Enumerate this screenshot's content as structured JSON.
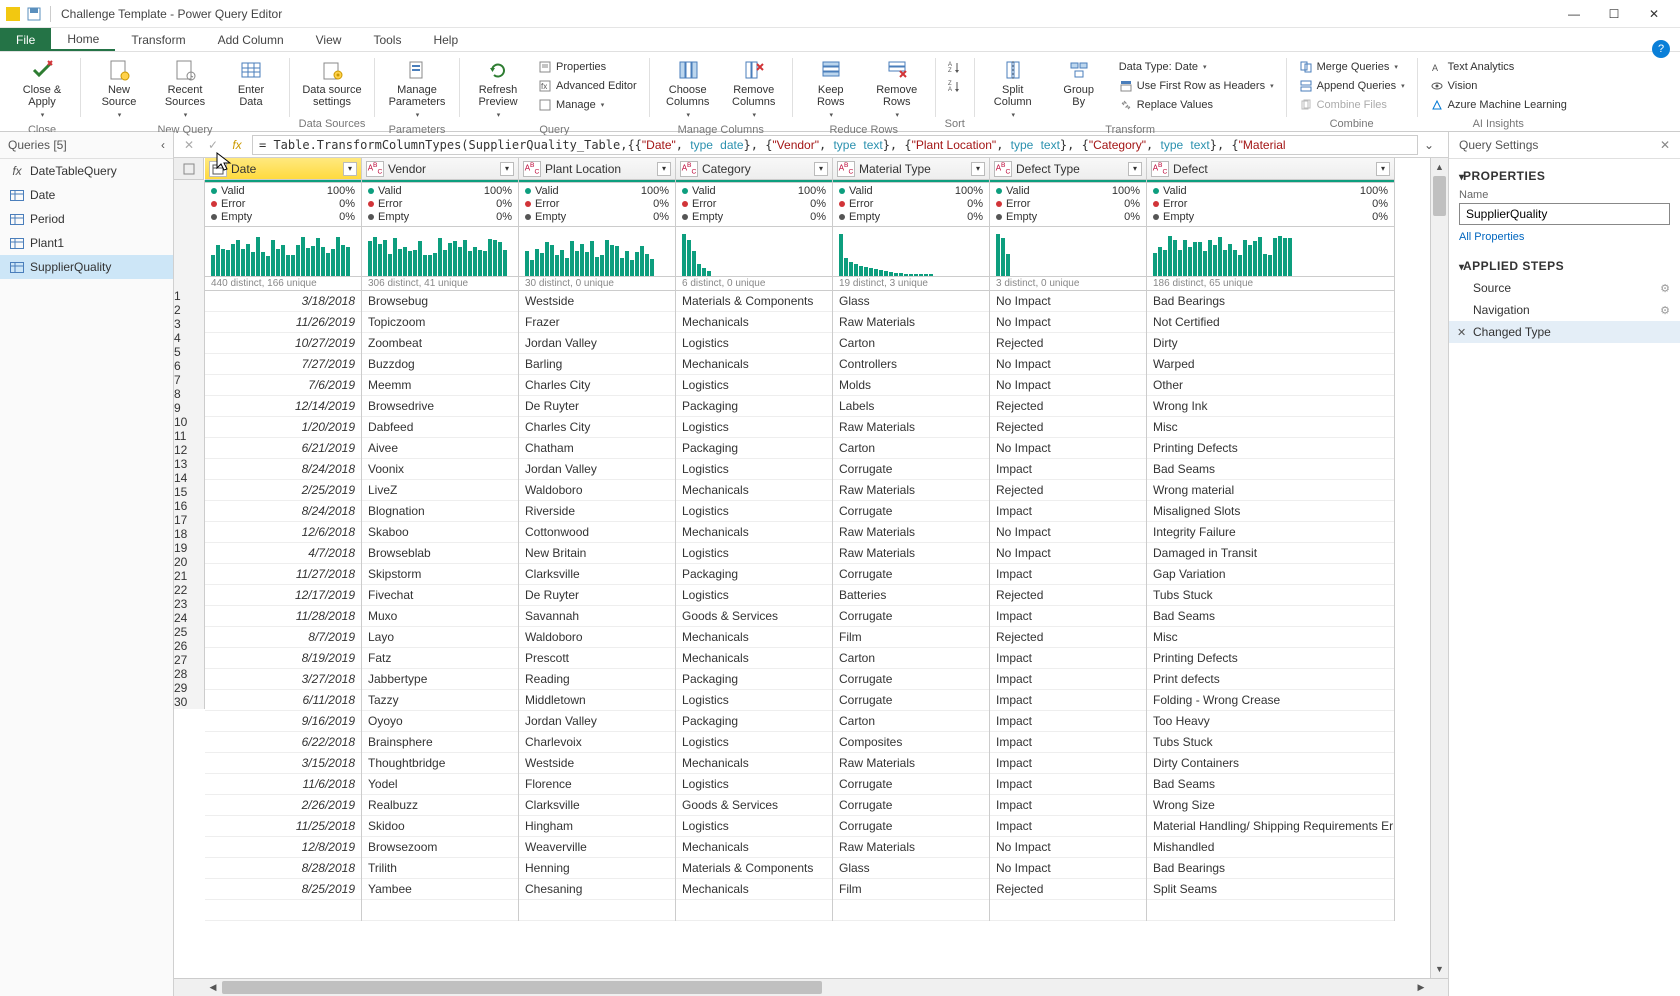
{
  "title": "Challenge Template - Power Query Editor",
  "tabs": {
    "file": "File",
    "home": "Home",
    "transform": "Transform",
    "addcolumn": "Add Column",
    "view": "View",
    "tools": "Tools",
    "help": "Help",
    "active": "Home"
  },
  "ribbon": {
    "close": {
      "closeapply": "Close &\nApply",
      "grp": "Close"
    },
    "newquery": {
      "newsource": "New\nSource",
      "recentsources": "Recent\nSources",
      "enterdata": "Enter\nData",
      "grp": "New Query"
    },
    "datasources": {
      "dss": "Data source\nsettings",
      "grp": "Data Sources"
    },
    "parameters": {
      "mp": "Manage\nParameters",
      "grp": "Parameters"
    },
    "query": {
      "refresh": "Refresh\nPreview",
      "properties": "Properties",
      "advanced": "Advanced Editor",
      "manage": "Manage",
      "grp": "Query"
    },
    "managecols": {
      "choose": "Choose\nColumns",
      "remove": "Remove\nColumns",
      "grp": "Manage Columns"
    },
    "reducerows": {
      "keep": "Keep\nRows",
      "removerows": "Remove\nRows",
      "grp": "Reduce Rows"
    },
    "sort": {
      "grp": "Sort"
    },
    "transform": {
      "split": "Split\nColumn",
      "group": "Group\nBy",
      "datatype": "Data Type: Date",
      "firstrow": "Use First Row as Headers",
      "replace": "Replace Values",
      "grp": "Transform"
    },
    "combine": {
      "merge": "Merge Queries",
      "append": "Append Queries",
      "combinefiles": "Combine Files",
      "grp": "Combine"
    },
    "ai": {
      "textan": "Text Analytics",
      "vision": "Vision",
      "aml": "Azure Machine Learning",
      "grp": "AI Insights"
    }
  },
  "queries_panel": {
    "header": "Queries [5]",
    "items": [
      {
        "label": "DateTableQuery",
        "icon": "fx"
      },
      {
        "label": "Date",
        "icon": "table"
      },
      {
        "label": "Period",
        "icon": "table"
      },
      {
        "label": "Plant1",
        "icon": "table"
      },
      {
        "label": "SupplierQuality",
        "icon": "table",
        "selected": true
      }
    ]
  },
  "formula_plain": "= Table.TransformColumnTypes(SupplierQuality_Table,{{\"Date\", type date}, {\"Vendor\", type text}, {\"Plant Location\", type text}, {\"Category\", type text}, {\"Material",
  "columns": [
    {
      "key": "date",
      "label": "Date",
      "type": "cal",
      "selected": true,
      "valid": "100%",
      "error": "0%",
      "empty": "0%",
      "note": "440 distinct, 166 unique",
      "spark": "dense"
    },
    {
      "key": "vendor",
      "label": "Vendor",
      "type": "abc",
      "valid": "100%",
      "error": "0%",
      "empty": "0%",
      "note": "306 distinct, 41 unique",
      "spark": "dense"
    },
    {
      "key": "plant",
      "label": "Plant Location",
      "type": "abc",
      "valid": "100%",
      "error": "0%",
      "empty": "0%",
      "note": "30 distinct, 0 unique",
      "spark": "dense2"
    },
    {
      "key": "category",
      "label": "Category",
      "type": "abc",
      "valid": "100%",
      "error": "0%",
      "empty": "0%",
      "note": "6 distinct, 0 unique",
      "spark": "few"
    },
    {
      "key": "material",
      "label": "Material Type",
      "type": "abc",
      "valid": "100%",
      "error": "0%",
      "empty": "0%",
      "note": "19 distinct, 3 unique",
      "spark": "sparse"
    },
    {
      "key": "deftype",
      "label": "Defect Type",
      "type": "abc",
      "valid": "100%",
      "error": "0%",
      "empty": "0%",
      "note": "3 distinct, 0 unique",
      "spark": "three"
    },
    {
      "key": "defect",
      "label": "Defect",
      "type": "abc",
      "valid": "100%",
      "error": "0%",
      "empty": "0%",
      "note": "186 distinct, 65 unique",
      "spark": "dense"
    }
  ],
  "statlabels": {
    "valid": "Valid",
    "error": "Error",
    "empty": "Empty"
  },
  "rows": [
    {
      "n": 1,
      "date": "3/18/2018",
      "vendor": "Browsebug",
      "plant": "Westside",
      "category": "Materials & Components",
      "material": "Glass",
      "deftype": "No Impact",
      "defect": "Bad Bearings"
    },
    {
      "n": 2,
      "date": "11/26/2019",
      "vendor": "Topiczoom",
      "plant": "Frazer",
      "category": "Mechanicals",
      "material": "Raw Materials",
      "deftype": "No Impact",
      "defect": "Not Certified"
    },
    {
      "n": 3,
      "date": "10/27/2019",
      "vendor": "Zoombeat",
      "plant": "Jordan Valley",
      "category": "Logistics",
      "material": "Carton",
      "deftype": "Rejected",
      "defect": "Dirty"
    },
    {
      "n": 4,
      "date": "7/27/2019",
      "vendor": "Buzzdog",
      "plant": "Barling",
      "category": "Mechanicals",
      "material": "Controllers",
      "deftype": "No Impact",
      "defect": "Warped"
    },
    {
      "n": 5,
      "date": "7/6/2019",
      "vendor": "Meemm",
      "plant": "Charles City",
      "category": "Logistics",
      "material": "Molds",
      "deftype": "No Impact",
      "defect": "Other"
    },
    {
      "n": 6,
      "date": "12/14/2019",
      "vendor": "Browsedrive",
      "plant": "De Ruyter",
      "category": "Packaging",
      "material": "Labels",
      "deftype": "Rejected",
      "defect": "Wrong Ink"
    },
    {
      "n": 7,
      "date": "1/20/2019",
      "vendor": "Dabfeed",
      "plant": "Charles City",
      "category": "Logistics",
      "material": "Raw Materials",
      "deftype": "Rejected",
      "defect": "Misc"
    },
    {
      "n": 8,
      "date": "6/21/2019",
      "vendor": "Aivee",
      "plant": "Chatham",
      "category": "Packaging",
      "material": "Carton",
      "deftype": "No Impact",
      "defect": "Printing Defects"
    },
    {
      "n": 9,
      "date": "8/24/2018",
      "vendor": "Voonix",
      "plant": "Jordan Valley",
      "category": "Logistics",
      "material": "Corrugate",
      "deftype": "Impact",
      "defect": "Bad Seams"
    },
    {
      "n": 10,
      "date": "2/25/2019",
      "vendor": "LiveZ",
      "plant": "Waldoboro",
      "category": "Mechanicals",
      "material": "Raw Materials",
      "deftype": "Rejected",
      "defect": "Wrong material"
    },
    {
      "n": 11,
      "date": "8/24/2018",
      "vendor": "Blognation",
      "plant": "Riverside",
      "category": "Logistics",
      "material": "Corrugate",
      "deftype": "Impact",
      "defect": "Misaligned Slots"
    },
    {
      "n": 12,
      "date": "12/6/2018",
      "vendor": "Skaboo",
      "plant": "Cottonwood",
      "category": "Mechanicals",
      "material": "Raw Materials",
      "deftype": "No Impact",
      "defect": "Integrity Failure"
    },
    {
      "n": 13,
      "date": "4/7/2018",
      "vendor": "Browseblab",
      "plant": "New Britain",
      "category": "Logistics",
      "material": "Raw Materials",
      "deftype": "No Impact",
      "defect": "Damaged in Transit"
    },
    {
      "n": 14,
      "date": "11/27/2018",
      "vendor": "Skipstorm",
      "plant": "Clarksville",
      "category": "Packaging",
      "material": "Corrugate",
      "deftype": "Impact",
      "defect": "Gap Variation"
    },
    {
      "n": 15,
      "date": "12/17/2019",
      "vendor": "Fivechat",
      "plant": "De Ruyter",
      "category": "Logistics",
      "material": "Batteries",
      "deftype": "Rejected",
      "defect": "Tubs Stuck"
    },
    {
      "n": 16,
      "date": "11/28/2018",
      "vendor": "Muxo",
      "plant": "Savannah",
      "category": "Goods & Services",
      "material": "Corrugate",
      "deftype": "Impact",
      "defect": "Bad Seams"
    },
    {
      "n": 17,
      "date": "8/7/2019",
      "vendor": "Layo",
      "plant": "Waldoboro",
      "category": "Mechanicals",
      "material": "Film",
      "deftype": "Rejected",
      "defect": "Misc"
    },
    {
      "n": 18,
      "date": "8/19/2019",
      "vendor": "Fatz",
      "plant": "Prescott",
      "category": "Mechanicals",
      "material": "Carton",
      "deftype": "Impact",
      "defect": "Printing Defects"
    },
    {
      "n": 19,
      "date": "3/27/2018",
      "vendor": "Jabbertype",
      "plant": "Reading",
      "category": "Packaging",
      "material": "Corrugate",
      "deftype": "Impact",
      "defect": "Print defects"
    },
    {
      "n": 20,
      "date": "6/11/2018",
      "vendor": "Tazzy",
      "plant": "Middletown",
      "category": "Logistics",
      "material": "Corrugate",
      "deftype": "Impact",
      "defect": "Folding - Wrong Crease"
    },
    {
      "n": 21,
      "date": "9/16/2019",
      "vendor": "Oyoyo",
      "plant": "Jordan Valley",
      "category": "Packaging",
      "material": "Carton",
      "deftype": "Impact",
      "defect": "Too Heavy"
    },
    {
      "n": 22,
      "date": "6/22/2018",
      "vendor": "Brainsphere",
      "plant": "Charlevoix",
      "category": "Logistics",
      "material": "Composites",
      "deftype": "Impact",
      "defect": "Tubs Stuck"
    },
    {
      "n": 23,
      "date": "3/15/2018",
      "vendor": "Thoughtbridge",
      "plant": "Westside",
      "category": "Mechanicals",
      "material": "Raw Materials",
      "deftype": "Impact",
      "defect": "Dirty Containers"
    },
    {
      "n": 24,
      "date": "11/6/2018",
      "vendor": "Yodel",
      "plant": "Florence",
      "category": "Logistics",
      "material": "Corrugate",
      "deftype": "Impact",
      "defect": "Bad Seams"
    },
    {
      "n": 25,
      "date": "2/26/2019",
      "vendor": "Realbuzz",
      "plant": "Clarksville",
      "category": "Goods & Services",
      "material": "Corrugate",
      "deftype": "Impact",
      "defect": "Wrong Size"
    },
    {
      "n": 26,
      "date": "11/25/2018",
      "vendor": "Skidoo",
      "plant": "Hingham",
      "category": "Logistics",
      "material": "Corrugate",
      "deftype": "Impact",
      "defect": "Material Handling/ Shipping Requirements Error"
    },
    {
      "n": 27,
      "date": "12/8/2019",
      "vendor": "Browsezoom",
      "plant": "Weaverville",
      "category": "Mechanicals",
      "material": "Raw Materials",
      "deftype": "No Impact",
      "defect": "Mishandled"
    },
    {
      "n": 28,
      "date": "8/28/2018",
      "vendor": "Trilith",
      "plant": "Henning",
      "category": "Materials & Components",
      "material": "Glass",
      "deftype": "No Impact",
      "defect": "Bad Bearings"
    },
    {
      "n": 29,
      "date": "8/25/2019",
      "vendor": "Yambee",
      "plant": "Chesaning",
      "category": "Mechanicals",
      "material": "Film",
      "deftype": "Rejected",
      "defect": "Split Seams"
    },
    {
      "n": 30,
      "date": "",
      "vendor": "",
      "plant": "",
      "category": "",
      "material": "",
      "deftype": "",
      "defect": ""
    }
  ],
  "settings": {
    "header": "Query Settings",
    "properties_title": "PROPERTIES",
    "name_label": "Name",
    "name_value": "SupplierQuality",
    "all_props": "All Properties",
    "steps_title": "APPLIED STEPS",
    "steps": [
      {
        "label": "Source",
        "gear": true
      },
      {
        "label": "Navigation",
        "gear": true
      },
      {
        "label": "Changed Type",
        "selected": true,
        "deletable": true
      }
    ]
  }
}
